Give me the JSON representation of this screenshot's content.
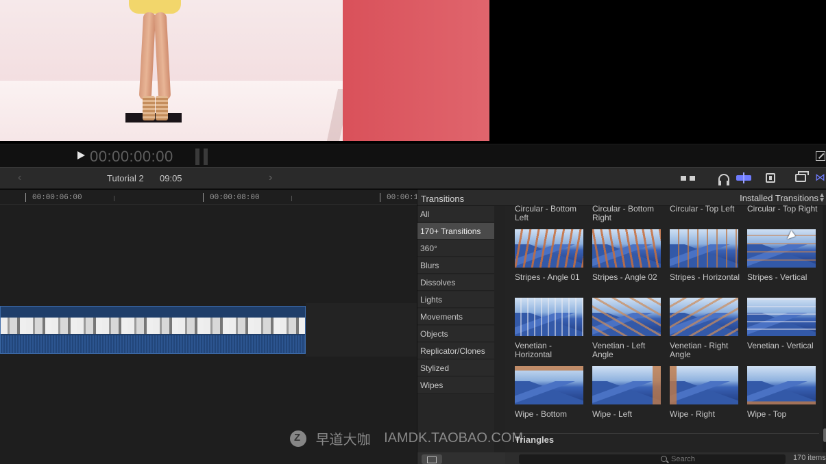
{
  "viewer": {
    "timecode": "00:00:00:00"
  },
  "timeline_toolbar": {
    "project_name": "Tutorial 2",
    "project_duration": "09:05",
    "icons": [
      "skimming-icon",
      "headphones-icon",
      "snapping-icon",
      "clip-appearance-icon",
      "window-icon",
      "transitions-browser-icon"
    ],
    "accent_color": "#6f7cff"
  },
  "ruler": {
    "labels": [
      "00:00:06:00",
      "00:00:08:00",
      "00:00:1"
    ]
  },
  "transitions": {
    "title": "Transitions",
    "filter": "Installed Transitions",
    "categories": [
      {
        "label": "All",
        "selected": false
      },
      {
        "label": "170+ Transitions",
        "selected": true
      },
      {
        "label": "360°",
        "selected": false
      },
      {
        "label": "Blurs",
        "selected": false
      },
      {
        "label": "Dissolves",
        "selected": false
      },
      {
        "label": "Lights",
        "selected": false
      },
      {
        "label": "Movements",
        "selected": false
      },
      {
        "label": "Objects",
        "selected": false
      },
      {
        "label": "Replicator/Clones",
        "selected": false
      },
      {
        "label": "Stylized",
        "selected": false
      },
      {
        "label": "Wipes",
        "selected": false
      }
    ],
    "top_labels": [
      "Circular - Bottom Left",
      "Circular - Bottom Right",
      "Circular - Top Left",
      "Circular - Top Right"
    ],
    "rows": [
      [
        {
          "label": "Stripes - Angle 01",
          "style": "stripes-angle1"
        },
        {
          "label": "Stripes - Angle 02",
          "style": "stripes-angle2"
        },
        {
          "label": "Stripes - Horizontal",
          "style": "stripes-vert"
        },
        {
          "label": "Stripes - Vertical",
          "style": "stripes-horiz"
        }
      ],
      [
        {
          "label": "Venetian - Horizontal",
          "style": "ven-h"
        },
        {
          "label": "Venetian - Left Angle",
          "style": "ven-l"
        },
        {
          "label": "Venetian - Right Angle",
          "style": "ven-r"
        },
        {
          "label": "Venetian - Vertical",
          "style": "ven-v"
        }
      ],
      [
        {
          "label": "Wipe - Bottom",
          "style": "wipe-b"
        },
        {
          "label": "Wipe - Left",
          "style": "wipe-l"
        },
        {
          "label": "Wipe - Right",
          "style": "wipe-r"
        },
        {
          "label": "Wipe - Top",
          "style": "wipe-t"
        }
      ]
    ],
    "section_title": "Triangles",
    "search_placeholder": "Search",
    "item_count": "170 items"
  },
  "watermark": {
    "text_cn": "早道大咖",
    "text_url": "IAMDK.TAOBAO.COM"
  }
}
